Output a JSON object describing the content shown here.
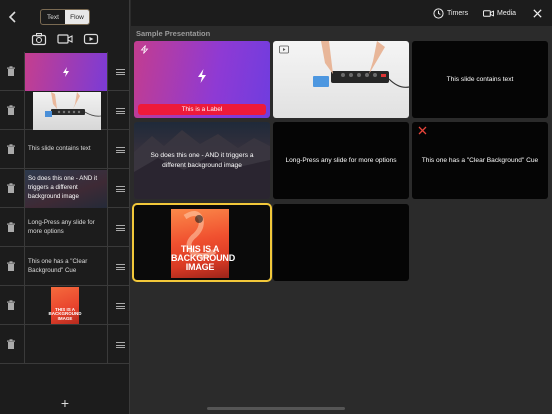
{
  "sidebar": {
    "segmented": [
      {
        "label": "Text",
        "active": false
      },
      {
        "label": "Flow",
        "active": true
      }
    ],
    "media_icons": [
      "camera-icon",
      "video-camera-icon",
      "youtube-icon"
    ],
    "rows": [
      {
        "kind": "gradient",
        "text": ""
      },
      {
        "kind": "photo",
        "text": ""
      },
      {
        "kind": "text",
        "text": "This slide contains text"
      },
      {
        "kind": "mountain",
        "text": "So does this one - AND it triggers a different background image"
      },
      {
        "kind": "text",
        "text": "Long-Press any slide for more options"
      },
      {
        "kind": "text",
        "text": "This one has a \"Clear Background\" Cue"
      },
      {
        "kind": "flamingo",
        "text": "THIS IS A BACKGROUND IMAGE"
      },
      {
        "kind": "empty",
        "text": ""
      }
    ],
    "add_label": "+"
  },
  "topbar": {
    "timers_label": "Timers",
    "media_label": "Media"
  },
  "main": {
    "section_title": "Sample Presentation",
    "slides": [
      {
        "text": "",
        "label": "This is a Label",
        "icon": "bolt-icon"
      },
      {
        "text": "",
        "icon": "video-icon"
      },
      {
        "text": "This slide contains text"
      },
      {
        "text": "So does this one - AND it triggers a different background image"
      },
      {
        "text": "Long-Press any slide for more options"
      },
      {
        "text": "This one has a \"Clear Background\" Cue",
        "icon": "clear-x-icon"
      },
      {
        "text": "THIS IS A BACKGROUND IMAGE",
        "selected": true
      },
      {
        "text": ""
      }
    ]
  },
  "colors": {
    "accent_selected": "#f2c83a",
    "label_red": "#ee1a3a",
    "gradient_start": "#c33d8f",
    "gradient_end": "#6f3ddf"
  }
}
